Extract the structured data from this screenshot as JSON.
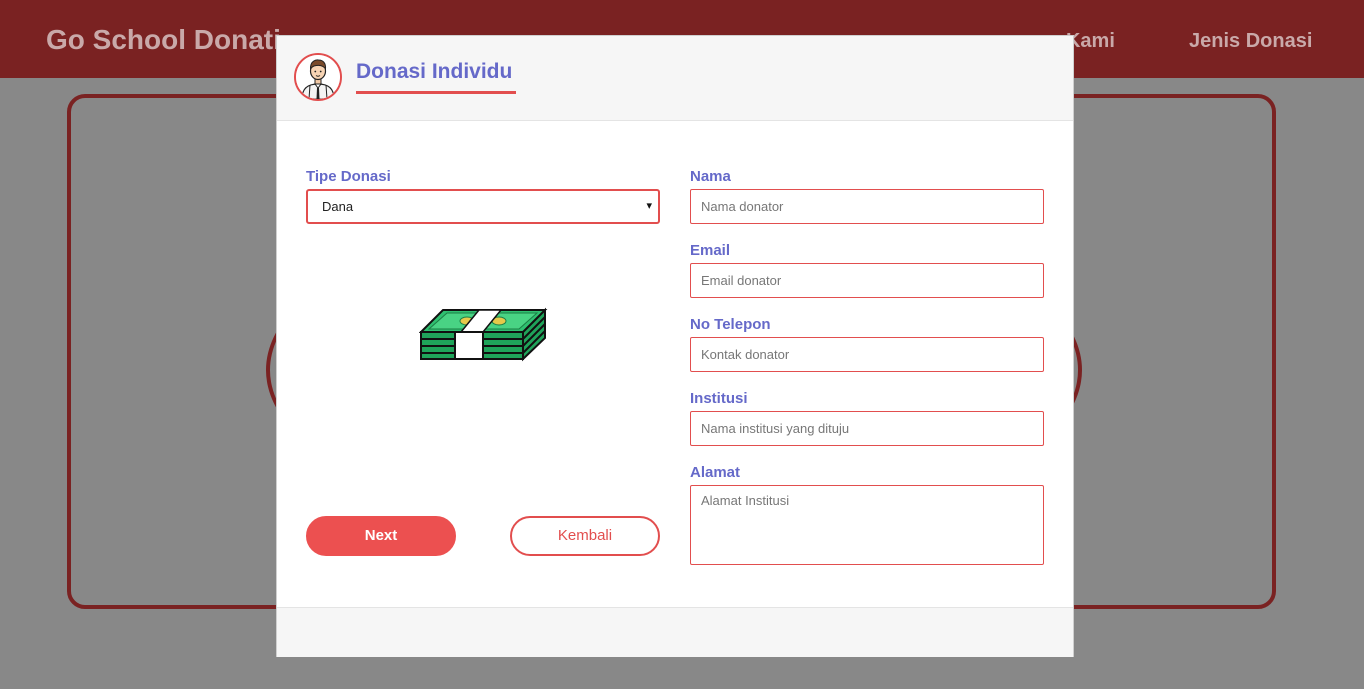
{
  "background": {
    "brand": "Go School Donati",
    "nav": {
      "tentang_kami": "ng Kami",
      "jenis_donasi": "Jenis Donasi"
    }
  },
  "modal": {
    "title": "Donasi Individu",
    "avatar_icon": "user-avatar-icon",
    "tipe_donasi": {
      "label": "Tipe Donasi",
      "selected": "Dana",
      "arrow": "▾"
    },
    "illustration_icon": "money-stack-icon",
    "fields": {
      "nama": {
        "label": "Nama",
        "placeholder": "Nama donator"
      },
      "email": {
        "label": "Email",
        "placeholder": "Email donator"
      },
      "telepon": {
        "label": "No Telepon",
        "placeholder": "Kontak donator"
      },
      "institusi": {
        "label": "Institusi",
        "placeholder": "Nama institusi yang dituju"
      },
      "alamat": {
        "label": "Alamat",
        "placeholder": "Alamat Institusi"
      }
    },
    "buttons": {
      "next": "Next",
      "back": "Kembali"
    }
  },
  "colors": {
    "accent": "#e24e4e",
    "label": "#6569c9",
    "navbar": "#7a2222",
    "overlay": "#888888"
  }
}
